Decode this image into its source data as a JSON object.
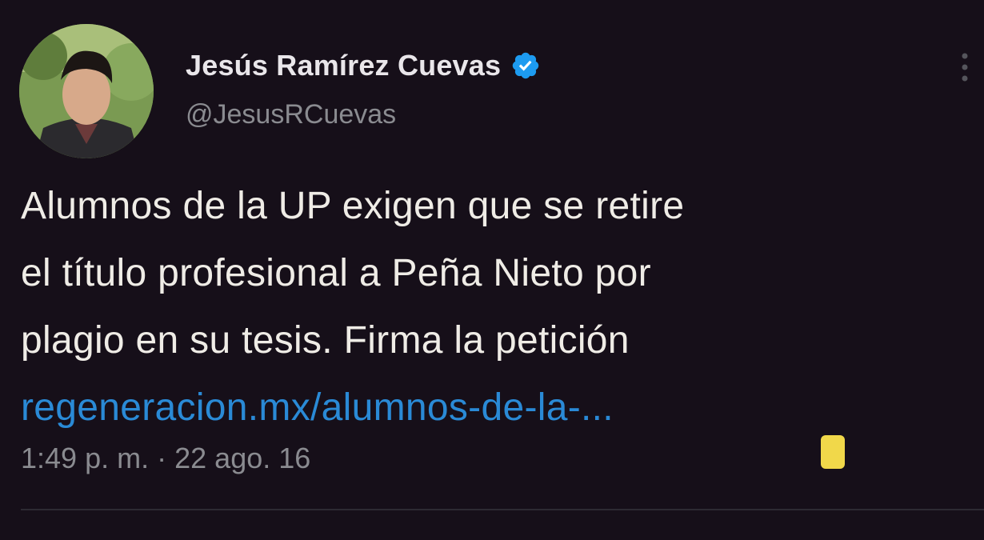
{
  "tweet": {
    "author": {
      "display_name": "Jesús Ramírez Cuevas",
      "handle": "@JesusRCuevas",
      "verified": true,
      "verified_icon": "verified-badge-icon"
    },
    "more_icon": "more-options-icon",
    "text_lines": [
      "Alumnos de la UP exigen que se retire",
      "el título profesional a Peña Nieto por",
      "plagio en su tesis. Firma la petición"
    ],
    "link_text": "regeneracion.mx/alumnos-de-la-...",
    "time": "1:49 p. m.",
    "separator": "·",
    "date": "22 ago. 16"
  },
  "colors": {
    "background": "#160f19",
    "link": "#2a8ad6",
    "verified": "#1d9bf0",
    "secondary_text": "#8a8b90",
    "sticker": "#f1d84a"
  }
}
